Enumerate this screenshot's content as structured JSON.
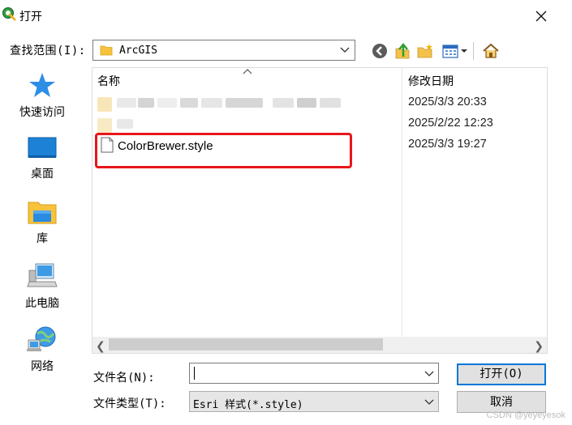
{
  "window": {
    "title": "打开",
    "close_icon": "close-icon"
  },
  "toolbar": {
    "look_in_label": "查找范围(I):",
    "look_in_value": "ArcGIS",
    "icons": [
      "back-icon",
      "up-folder-icon",
      "new-folder-icon",
      "view-menu-icon",
      "home-icon"
    ]
  },
  "places": [
    {
      "label": "快速访问",
      "icon": "star-icon"
    },
    {
      "label": "桌面",
      "icon": "desktop-icon"
    },
    {
      "label": "库",
      "icon": "library-icon"
    },
    {
      "label": "此电脑",
      "icon": "computer-icon"
    },
    {
      "label": "网络",
      "icon": "network-icon"
    }
  ],
  "file_list": {
    "columns": {
      "name": "名称",
      "date": "修改日期"
    },
    "rows": [
      {
        "name": "",
        "date": "2025/3/3 20:33",
        "redacted": true
      },
      {
        "name": "",
        "date": "2025/2/22 12:23",
        "redacted": true
      },
      {
        "name": "ColorBrewer.style",
        "date": "2025/3/3 19:27",
        "highlighted": true
      }
    ]
  },
  "bottom": {
    "filename_label": "文件名(N):",
    "filename_value": "",
    "filetype_label": "文件类型(T):",
    "filetype_value": "Esri 样式(*.style)",
    "open_button": "打开(O)",
    "cancel_button": "取消"
  },
  "watermark": "CSDN @yeyeyesok",
  "colors": {
    "highlight_border": "#e8161c",
    "focus_border": "#0078d7",
    "folder_yellow": "#f8c33c"
  }
}
